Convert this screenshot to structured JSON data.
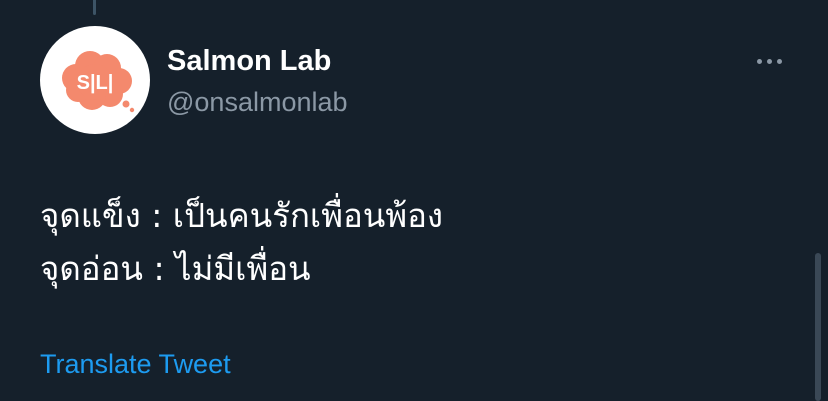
{
  "tweet": {
    "author": {
      "display_name": "Salmon Lab",
      "handle": "@onsalmonlab",
      "avatar_text": "S|L|"
    },
    "text_lines": [
      "จุดแข็ง : เป็นคนรักเพื่อนพ้อง",
      "จุดอ่อน : ไม่มีเพื่อน"
    ],
    "translate_label": "Translate Tweet"
  },
  "icons": {
    "more": "more-horizontal-icon"
  },
  "colors": {
    "background": "#15202b",
    "primary_text": "#ffffff",
    "secondary_text": "#8b98a5",
    "link": "#1d9bf0",
    "avatar_cloud": "#f4896d"
  }
}
